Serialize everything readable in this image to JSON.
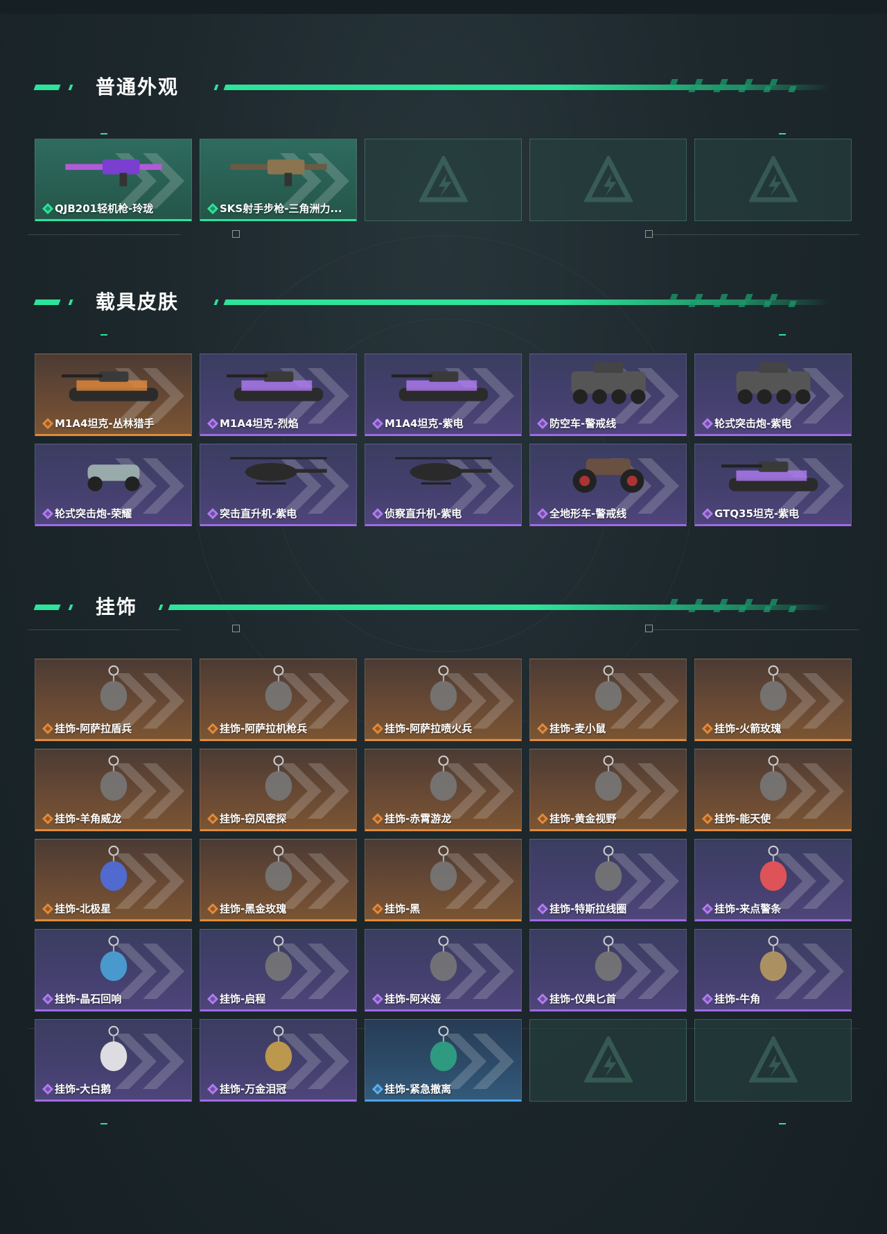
{
  "sections": [
    {
      "title": "普通外观",
      "items": [
        {
          "label": "QJB201轻机枪-玲珑",
          "rarity": "green",
          "icon": "machine-gun-icon"
        },
        {
          "label": "SKS射手步枪-三角洲力...",
          "rarity": "green",
          "icon": "rifle-icon"
        },
        {
          "label": "",
          "rarity": "empty",
          "icon": "empty-slot-icon"
        },
        {
          "label": "",
          "rarity": "empty",
          "icon": "empty-slot-icon"
        },
        {
          "label": "",
          "rarity": "empty",
          "icon": "empty-slot-icon"
        }
      ]
    },
    {
      "title": "载具皮肤",
      "items": [
        {
          "label": "M1A4坦克-丛林猎手",
          "rarity": "orange",
          "icon": "tank-icon"
        },
        {
          "label": "M1A4坦克-烈焰",
          "rarity": "purple",
          "icon": "tank-icon"
        },
        {
          "label": "M1A4坦克-紫电",
          "rarity": "purple",
          "icon": "tank-icon"
        },
        {
          "label": "防空车-警戒线",
          "rarity": "purple",
          "icon": "armored-car-icon"
        },
        {
          "label": "轮式突击炮-紫电",
          "rarity": "purple",
          "icon": "armored-car-icon"
        },
        {
          "label": "轮式突击炮-荣耀",
          "rarity": "purple",
          "icon": "buggy-icon"
        },
        {
          "label": "突击直升机-紫电",
          "rarity": "purple",
          "icon": "helicopter-icon"
        },
        {
          "label": "侦察直升机-紫电",
          "rarity": "purple",
          "icon": "helicopter-icon"
        },
        {
          "label": "全地形车-警戒线",
          "rarity": "purple",
          "icon": "atv-icon"
        },
        {
          "label": "GTQ35坦克-紫电",
          "rarity": "purple",
          "icon": "tank-icon"
        }
      ]
    },
    {
      "title": "挂饰",
      "items": [
        {
          "label": "挂饰-阿萨拉盾兵",
          "rarity": "orange",
          "icon": "charm-figure-icon"
        },
        {
          "label": "挂饰-阿萨拉机枪兵",
          "rarity": "orange",
          "icon": "charm-figure-icon"
        },
        {
          "label": "挂饰-阿萨拉喷火兵",
          "rarity": "orange",
          "icon": "charm-figure-icon"
        },
        {
          "label": "挂饰-麦小鼠",
          "rarity": "orange",
          "icon": "charm-mouse-icon"
        },
        {
          "label": "挂饰-火箭玫瑰",
          "rarity": "orange",
          "icon": "charm-figure-icon"
        },
        {
          "label": "挂饰-羊角威龙",
          "rarity": "orange",
          "icon": "charm-figure-icon"
        },
        {
          "label": "挂饰-窃风密探",
          "rarity": "orange",
          "icon": "charm-figure-icon"
        },
        {
          "label": "挂饰-赤霄游龙",
          "rarity": "orange",
          "icon": "charm-figure-icon"
        },
        {
          "label": "挂饰-黄金视野",
          "rarity": "orange",
          "icon": "charm-figure-icon"
        },
        {
          "label": "挂饰-能天使",
          "rarity": "orange",
          "icon": "charm-tag-icon"
        },
        {
          "label": "挂饰-北极星",
          "rarity": "orange",
          "icon": "charm-star-icon"
        },
        {
          "label": "挂饰-黑金玫瑰",
          "rarity": "orange",
          "icon": "charm-rose-icon"
        },
        {
          "label": "挂饰-黑",
          "rarity": "orange",
          "icon": "charm-tag-icon"
        },
        {
          "label": "挂饰-特斯拉线圈",
          "rarity": "purple",
          "icon": "charm-coil-icon"
        },
        {
          "label": "挂饰-来点警条",
          "rarity": "purple",
          "icon": "charm-fire-icon"
        },
        {
          "label": "挂饰-晶石回响",
          "rarity": "purple",
          "icon": "charm-crystal-icon"
        },
        {
          "label": "挂饰-启程",
          "rarity": "purple",
          "icon": "charm-medal-icon"
        },
        {
          "label": "挂饰-阿米娅",
          "rarity": "purple",
          "icon": "charm-bunny-icon"
        },
        {
          "label": "挂饰-仪典匕首",
          "rarity": "purple",
          "icon": "charm-dagger-icon"
        },
        {
          "label": "挂饰-牛角",
          "rarity": "purple",
          "icon": "charm-horns-icon"
        },
        {
          "label": "挂饰-大白鹅",
          "rarity": "purple",
          "icon": "charm-goose-icon"
        },
        {
          "label": "挂饰-万金泪冠",
          "rarity": "purple",
          "icon": "charm-crown-icon"
        },
        {
          "label": "挂饰-紧急撤离",
          "rarity": "blue",
          "icon": "charm-exit-icon"
        },
        {
          "label": "",
          "rarity": "empty",
          "icon": "empty-slot-icon"
        },
        {
          "label": "",
          "rarity": "empty",
          "icon": "empty-slot-icon"
        }
      ]
    }
  ],
  "colors": {
    "accent": "#2ee39a",
    "orange": "#e28a3c",
    "purple": "#9f6ae6",
    "blue": "#4aa3f0",
    "background": "#1d282d"
  }
}
